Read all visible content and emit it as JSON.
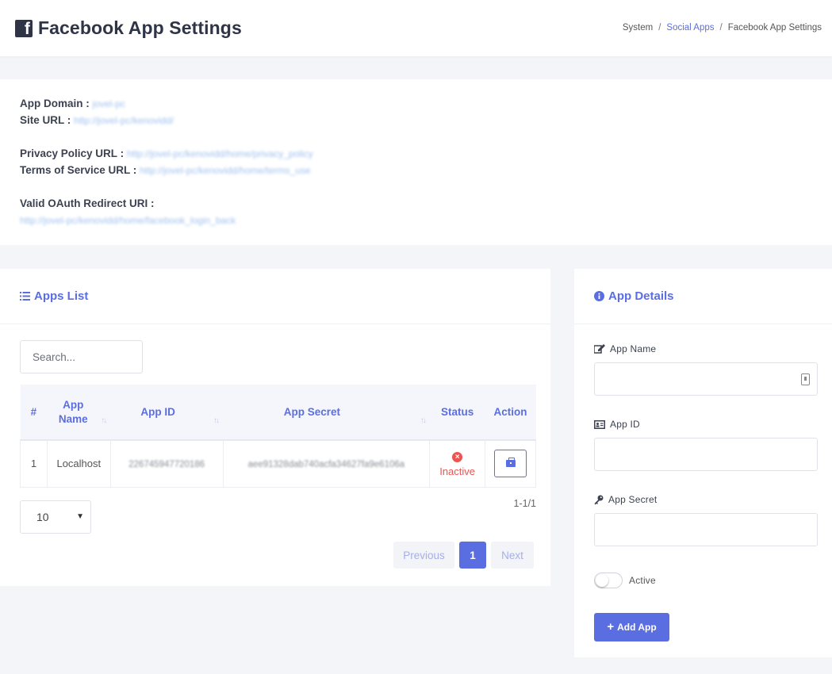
{
  "header": {
    "title": "Facebook App Settings",
    "breadcrumb": [
      "System",
      "Social Apps",
      "Facebook App Settings"
    ],
    "breadcrumb_sep": "/"
  },
  "info": {
    "app_domain_label": "App Domain :",
    "app_domain_value": "jovel-pc",
    "site_url_label": "Site URL :",
    "site_url_value": "http://jovel-pc/kenovidd/",
    "privacy_label": "Privacy Policy URL :",
    "privacy_value": "http://jovel-pc/kenovidd/home/privacy_policy",
    "terms_label": "Terms of Service URL :",
    "terms_value": "http://jovel-pc/kenovidd/home/terms_use",
    "oauth_label": "Valid OAuth Redirect URI :",
    "oauth_value": "http://jovel-pc/kenovidd/home/facebook_login_back"
  },
  "apps_list": {
    "title": "Apps List",
    "search_placeholder": "Search...",
    "columns": [
      "#",
      "App Name",
      "App ID",
      "App Secret",
      "Status",
      "Action"
    ],
    "rows": [
      {
        "num": "1",
        "name": "Localhost",
        "app_id": "226745947720186",
        "app_secret": "aee91328dab740acfa34627fa9e6106a",
        "status": "Inactive"
      }
    ],
    "count_text": "1-1/1",
    "per_page": "10",
    "pagination": {
      "previous": "Previous",
      "current": "1",
      "next": "Next"
    }
  },
  "details": {
    "title": "App Details",
    "app_name_label": "App Name",
    "app_id_label": "App ID",
    "app_secret_label": "App Secret",
    "active_label": "Active",
    "active": false,
    "add_button": "Add App"
  },
  "colors": {
    "accent": "#5b6ee1",
    "danger": "#ef5350",
    "background": "#f4f5f9"
  }
}
